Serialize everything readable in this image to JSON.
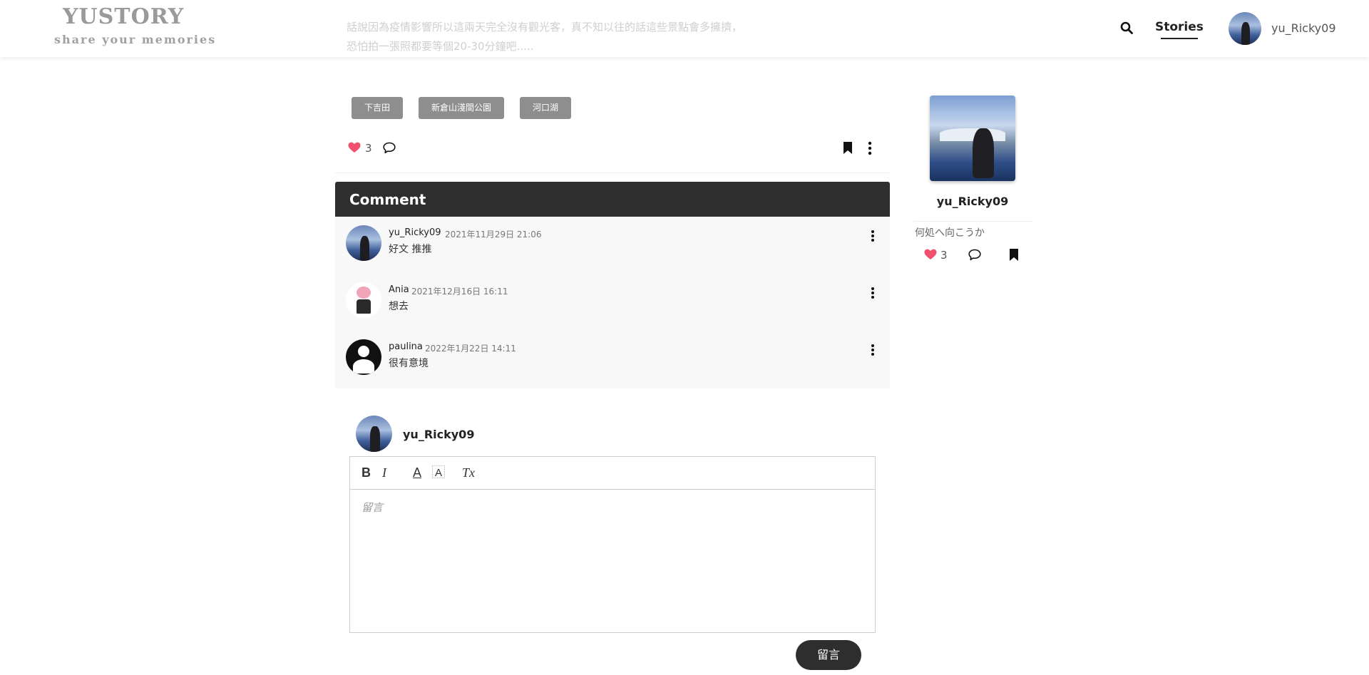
{
  "header": {
    "logo_title": "YUSTORY",
    "logo_subtitle": "share your memories",
    "faded_text_line1": "話說因為疫情影響所以這兩天完全沒有觀光客，真不知以往的話這些景點會多擁擠，",
    "faded_text_line2": "恐怕拍一張照都要等個20-30分鐘吧.....",
    "search_icon": "search-icon",
    "nav_stories": "Stories",
    "username": "yu_Ricky09"
  },
  "post": {
    "tags": [
      "下吉田",
      "新倉山淺間公園",
      "河口湖"
    ],
    "like_count": "3",
    "heart_color": "#f0506e"
  },
  "comments": {
    "title": "Comment",
    "items": [
      {
        "user": "yu_Ricky09",
        "date": "2021年11月29日 21:06",
        "text": "好文 推推",
        "avatar": "photo"
      },
      {
        "user": "Ania",
        "date": "2021年12月16日 16:11",
        "text": "想去",
        "avatar": "anime"
      },
      {
        "user": "paulina",
        "date": "2022年1月22日 14:11",
        "text": "很有意境",
        "avatar": "blank"
      }
    ]
  },
  "composer": {
    "username": "yu_Ricky09",
    "toolbar": {
      "bold": "B",
      "italic": "I",
      "color": "A",
      "clear": "Tx"
    },
    "placeholder": "留言",
    "submit_label": "留言"
  },
  "sidebar": {
    "username": "yu_Ricky09",
    "description": "何処へ向こうか",
    "like_count": "3"
  },
  "colors": {
    "accent_dark": "#2e2e2e",
    "tag_bg": "#8e8e8e",
    "heart": "#f0506e"
  }
}
